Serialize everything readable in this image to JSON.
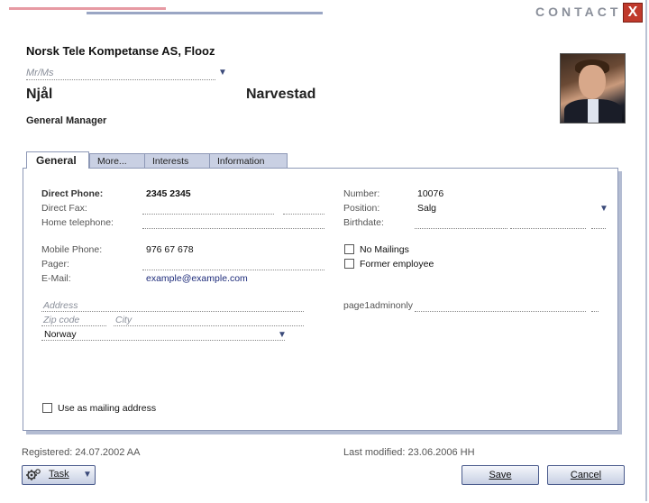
{
  "window": {
    "title": "CONTACT",
    "close_label": "X"
  },
  "contact": {
    "company": "Norsk Tele Kompetanse AS, Flooz",
    "salutation_placeholder": "Mr/Ms",
    "first_name": "Njål",
    "last_name": "Narvestad",
    "job_title": "General Manager"
  },
  "tabs": [
    {
      "label": "General",
      "active": true
    },
    {
      "label": "More...",
      "active": false
    },
    {
      "label": "Interests",
      "active": false
    },
    {
      "label": "Information",
      "active": false
    }
  ],
  "general": {
    "direct_phone_label": "Direct Phone:",
    "direct_phone": "2345 2345",
    "direct_fax_label": "Direct Fax:",
    "home_phone_label": "Home telephone:",
    "mobile_label": "Mobile Phone:",
    "mobile": "976 67 678",
    "pager_label": "Pager:",
    "email_label": "E-Mail:",
    "email": "example@example.com",
    "number_label": "Number:",
    "number": "10076",
    "position_label": "Position:",
    "position": "Salg",
    "birthdate_label": "Birthdate:",
    "no_mailings_label": "No Mailings",
    "former_employee_label": "Former employee",
    "address_placeholder": "Address",
    "zip_placeholder": "Zip code",
    "city_placeholder": "City",
    "country": "Norway",
    "custom_field_label": "page1adminonly",
    "mailing_address_label": "Use as mailing address"
  },
  "footer": {
    "registered": "Registered: 24.07.2002 AA",
    "last_modified": "Last modified: 23.06.2006 HH",
    "task_label": "Task",
    "save_label": "Save",
    "cancel_label": "Cancel"
  },
  "colors": {
    "accent": "#4a5b8c",
    "tab_bg": "#c9d0e3",
    "panel_shadow": "#b3bcd2",
    "close": "#c0392b"
  },
  "icons": {
    "close": "close-icon",
    "dropdown": "chevron-down-icon",
    "task": "task-gear-icon",
    "photo": "contact-photo"
  }
}
